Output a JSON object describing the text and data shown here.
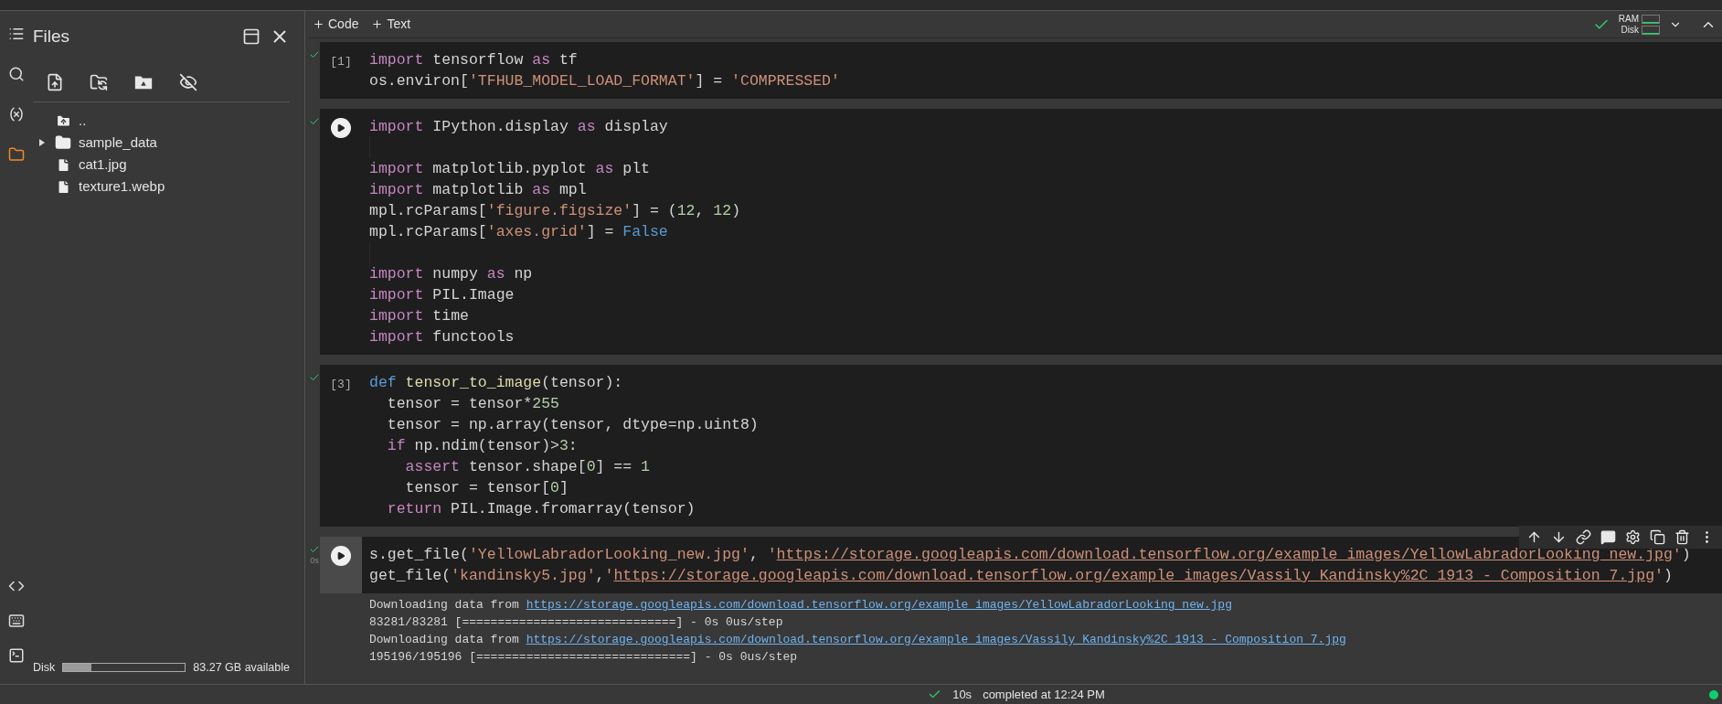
{
  "activity_bar": {
    "items": [
      {
        "selected": false
      },
      {
        "selected": false
      },
      {
        "selected": false
      },
      {
        "selected": true
      }
    ]
  },
  "files_panel": {
    "title": "Files",
    "tree": [
      {
        "name": "..",
        "kind": "parent"
      },
      {
        "name": "sample_data",
        "kind": "folder",
        "expanded": false
      },
      {
        "name": "cat1.jpg",
        "kind": "file"
      },
      {
        "name": "texture1.webp",
        "kind": "file"
      }
    ],
    "disk": {
      "label": "Disk",
      "level": 0.23,
      "reading": "83.27 GB available"
    }
  },
  "toolbar": {
    "buttons": [
      "Code",
      "Text"
    ],
    "resources": [
      "RAM",
      "Disk"
    ]
  },
  "cells": [
    {
      "prompt": "[1]",
      "done": true,
      "selected": false,
      "lines": [
        {
          "tokens": [
            {
              "kind": "keyword",
              "text": "import"
            },
            {
              "kind": "plain",
              "text": " tensorflow "
            },
            {
              "kind": "keyword",
              "text": "as"
            },
            {
              "kind": "plain",
              "text": " tf"
            }
          ]
        },
        {
          "tokens": [
            {
              "kind": "plain",
              "text": "os.environ["
            },
            {
              "kind": "string",
              "text": "'TFHUB_MODEL_LOAD_FORMAT'"
            },
            {
              "kind": "plain",
              "text": "] = "
            },
            {
              "kind": "string",
              "text": "'COMPRESSED'"
            }
          ]
        }
      ]
    },
    {
      "done": true,
      "selected": false,
      "lines": [
        {
          "tokens": [
            {
              "kind": "keyword",
              "text": "import"
            },
            {
              "kind": "plain",
              "text": " IPython.display "
            },
            {
              "kind": "keyword",
              "text": "as"
            },
            {
              "kind": "plain",
              "text": " display"
            }
          ]
        },
        {
          "blank_before": true,
          "tokens": [
            {
              "kind": "keyword",
              "text": "import"
            },
            {
              "kind": "plain",
              "text": " matplotlib.pyplot "
            },
            {
              "kind": "keyword",
              "text": "as"
            },
            {
              "kind": "plain",
              "text": " plt"
            }
          ]
        },
        {
          "tokens": [
            {
              "kind": "keyword",
              "text": "import"
            },
            {
              "kind": "plain",
              "text": " matplotlib "
            },
            {
              "kind": "keyword",
              "text": "as"
            },
            {
              "kind": "plain",
              "text": " mpl"
            }
          ]
        },
        {
          "tokens": [
            {
              "kind": "plain",
              "text": "mpl.rcParams["
            },
            {
              "kind": "string",
              "text": "'figure.figsize'"
            },
            {
              "kind": "plain",
              "text": "] = ("
            },
            {
              "kind": "number",
              "text": "12"
            },
            {
              "kind": "plain",
              "text": ", "
            },
            {
              "kind": "number",
              "text": "12"
            },
            {
              "kind": "plain",
              "text": ")"
            }
          ]
        },
        {
          "tokens": [
            {
              "kind": "plain",
              "text": "mpl.rcParams["
            },
            {
              "kind": "string",
              "text": "'axes.grid'"
            },
            {
              "kind": "plain",
              "text": "] = "
            },
            {
              "kind": "constant",
              "text": "False"
            }
          ]
        },
        {
          "blank_before": true,
          "tokens": [
            {
              "kind": "keyword",
              "text": "import"
            },
            {
              "kind": "plain",
              "text": " numpy "
            },
            {
              "kind": "keyword",
              "text": "as"
            },
            {
              "kind": "plain",
              "text": " np"
            }
          ]
        },
        {
          "tokens": [
            {
              "kind": "keyword",
              "text": "import"
            },
            {
              "kind": "plain",
              "text": " PIL.Image"
            }
          ]
        },
        {
          "tokens": [
            {
              "kind": "keyword",
              "text": "import"
            },
            {
              "kind": "plain",
              "text": " time"
            }
          ]
        },
        {
          "tokens": [
            {
              "kind": "keyword",
              "text": "import"
            },
            {
              "kind": "plain",
              "text": " functools"
            }
          ]
        }
      ]
    },
    {
      "prompt": "[3]",
      "done": true,
      "selected": false,
      "lines": [
        {
          "tokens": [
            {
              "kind": "constant",
              "text": "def"
            },
            {
              "kind": "function",
              "text": " tensor_to_image"
            },
            {
              "kind": "plain",
              "text": "(tensor):"
            }
          ]
        },
        {
          "tokens": [
            {
              "kind": "plain",
              "text": "  tensor = tensor*"
            },
            {
              "kind": "number",
              "text": "255"
            }
          ]
        },
        {
          "tokens": [
            {
              "kind": "plain",
              "text": "  tensor = np.array(tensor, dtype=np.uint8)"
            }
          ]
        },
        {
          "tokens": [
            {
              "kind": "keyword",
              "text": "  if"
            },
            {
              "kind": "plain",
              "text": " np.ndim(tensor)>"
            },
            {
              "kind": "number",
              "text": "3"
            },
            {
              "kind": "plain",
              "text": ":"
            }
          ]
        },
        {
          "tokens": [
            {
              "kind": "keyword",
              "text": "    assert"
            },
            {
              "kind": "plain",
              "text": " tensor.shape["
            },
            {
              "kind": "number",
              "text": "0"
            },
            {
              "kind": "plain",
              "text": "] == "
            },
            {
              "kind": "number",
              "text": "1"
            }
          ]
        },
        {
          "tokens": [
            {
              "kind": "plain",
              "text": "    tensor = tensor["
            },
            {
              "kind": "number",
              "text": "0"
            },
            {
              "kind": "plain",
              "text": "]"
            }
          ]
        },
        {
          "tokens": [
            {
              "kind": "keyword",
              "text": "  return"
            },
            {
              "kind": "plain",
              "text": " PIL.Image.fromarray(tensor)"
            }
          ]
        }
      ]
    },
    {
      "done": true,
      "duration": "0s",
      "selected": true,
      "lines": [
        {
          "tokens": [
            {
              "kind": "plain",
              "text": "s.get_file("
            },
            {
              "kind": "string",
              "text": "'YellowLabradorLooking_new.jpg'"
            },
            {
              "kind": "plain",
              "text": ", "
            },
            {
              "kind": "string",
              "text": "'"
            },
            {
              "kind": "url",
              "text": "https://storage.googleapis.com/download.tensorflow.org/example_images/YellowLabradorLooking_new.jpg"
            },
            {
              "kind": "string",
              "text": "'"
            },
            {
              "kind": "plain",
              "text": ")"
            }
          ]
        },
        {
          "tokens": [
            {
              "kind": "plain",
              "text": "get_file("
            },
            {
              "kind": "string",
              "text": "'kandinsky5.jpg'"
            },
            {
              "kind": "plain",
              "text": ","
            },
            {
              "kind": "string",
              "text": "'"
            },
            {
              "kind": "url",
              "text": "https://storage.googleapis.com/download.tensorflow.org/example_images/Vassily_Kandinsky%2C_1913_-_Composition_7.jpg"
            },
            {
              "kind": "string",
              "text": "'"
            },
            {
              "kind": "plain",
              "text": ")"
            }
          ]
        }
      ],
      "output": [
        [
          {
            "kind": "text",
            "text": "Downloading data from "
          },
          {
            "kind": "link",
            "text": "https://storage.googleapis.com/download.tensorflow.org/example_images/YellowLabradorLooking_new.jpg"
          }
        ],
        [
          {
            "kind": "text",
            "text": "83281/83281 [==============================] - 0s 0us/step"
          }
        ],
        [
          {
            "kind": "text",
            "text": "Downloading data from "
          },
          {
            "kind": "link",
            "text": "https://storage.googleapis.com/download.tensorflow.org/example_images/Vassily_Kandinsky%2C_1913_-_Composition_7.jpg"
          }
        ],
        [
          {
            "kind": "text",
            "text": "195196/195196 [==============================] - 0s 0us/step"
          }
        ]
      ]
    }
  ],
  "status_bar": {
    "done": true,
    "duration": "10s",
    "message": "completed at 12:24 PM",
    "connected": true
  }
}
